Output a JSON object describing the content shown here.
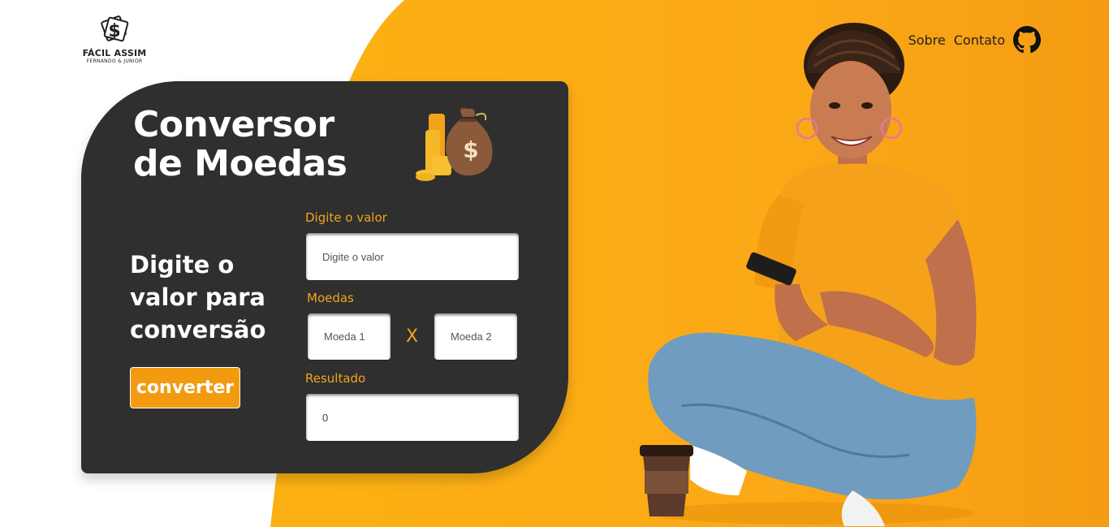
{
  "logo": {
    "brand": "FÁCIL ASSIM",
    "tagline": "FERNANDO & JUNIOR",
    "icon": "dollar-bills-icon"
  },
  "nav": {
    "items": [
      {
        "label": "Sobre"
      },
      {
        "label": "Contato"
      }
    ],
    "github_icon": "github-icon"
  },
  "card": {
    "title_line1": "Conversor",
    "title_line2": "de Moedas",
    "icon": "money-bag-icon",
    "prompt_line1": "Digite o",
    "prompt_line2": "valor para",
    "prompt_line3": "conversão",
    "convert_label": "converter"
  },
  "form": {
    "valor_label": "Digite o valor",
    "valor_placeholder": "Digite o valor",
    "moedas_label": "Moedas",
    "moeda1_placeholder": "Moeda 1",
    "separator": "X",
    "moeda2_placeholder": "Moeda 2",
    "resultado_label": "Resultado",
    "resultado_value": "0"
  },
  "colors": {
    "accent": "#f29b11",
    "background_orange": "#fbaa13",
    "card": "#2f2f2f",
    "label": "#f4a31e"
  }
}
